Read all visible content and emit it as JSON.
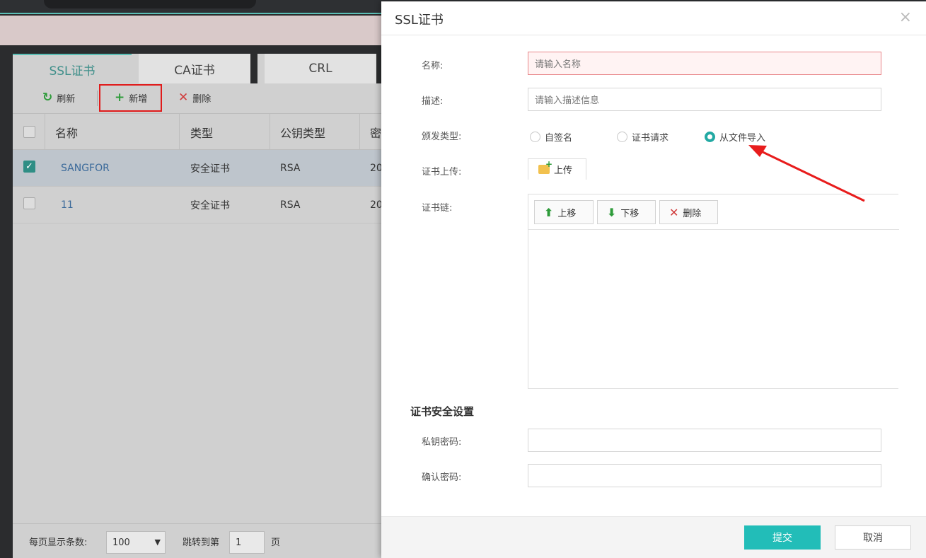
{
  "background": {
    "tabs": [
      {
        "label": "SSL证书",
        "active": true
      },
      {
        "label": "CA证书",
        "active": false
      },
      {
        "label": "CRL",
        "active": false
      }
    ],
    "toolbar": {
      "refresh_label": "刷新",
      "add_label": "新增",
      "delete_label": "删除"
    },
    "table": {
      "columns": [
        "名称",
        "类型",
        "公钥类型",
        "密"
      ],
      "rows": [
        {
          "checked": true,
          "name": "SANGFOR",
          "type": "安全证书",
          "key_type": "RSA",
          "date": "20"
        },
        {
          "checked": false,
          "name": "11",
          "type": "安全证书",
          "key_type": "RSA",
          "date": "20"
        }
      ]
    },
    "footer": {
      "page_size_label": "每页显示条数:",
      "page_size_value": "100",
      "jump_label": "跳转到第",
      "page_value": "1",
      "page_suffix": "页"
    }
  },
  "modal": {
    "title": "SSL证书",
    "close_symbol": "×",
    "fields": {
      "name_label": "名称:",
      "name_placeholder": "请输入名称",
      "desc_label": "描述:",
      "desc_placeholder": "请输入描述信息",
      "issue_type_label": "颁发类型:",
      "issue_options": [
        {
          "label": "自签名",
          "selected": false
        },
        {
          "label": "证书请求",
          "selected": false
        },
        {
          "label": "从文件导入",
          "selected": true
        }
      ],
      "upload_label": "证书上传:",
      "upload_button": "上传",
      "chain_label": "证书链:",
      "chain_buttons": {
        "up": "上移",
        "down": "下移",
        "delete": "删除"
      }
    },
    "security": {
      "section_title": "证书安全设置",
      "private_key_label": "私钥密码:",
      "confirm_label": "确认密码:"
    },
    "footer": {
      "submit": "提交",
      "cancel": "取消"
    }
  },
  "colors": {
    "accent": "#22bdb8",
    "highlight_red": "#e01b1b",
    "error_border": "#e8878b"
  }
}
